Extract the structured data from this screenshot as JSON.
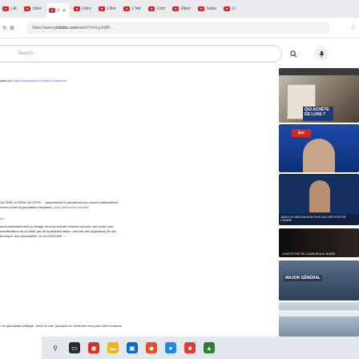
{
  "browser": {
    "tabs": [
      {
        "label": "Lib"
      },
      {
        "label": "Libre"
      },
      {
        "label": "L"
      },
      {
        "label": "Libre"
      },
      {
        "label": "Libre"
      },
      {
        "label": "L'intr"
      },
      {
        "label": "L'intr"
      },
      {
        "label": "Dijon"
      },
      {
        "label": "Suiss"
      },
      {
        "label": "Li"
      }
    ],
    "active_tab_index": 2,
    "url_prefix": "https://www.",
    "url_domain": "youtube.com",
    "url_rest": "/watch?v=ouyIU8F..."
  },
  "youtube": {
    "search_placeholder": "Search",
    "brand_color": "#e02020"
  },
  "description": {
    "line1_prefix": "yalté sur ",
    "line1_link": "https://www.france.tv/france-2/telema...",
    "block2_line1": "Us  DRM, la DRSD, la DGPN ... administrent et perpètrent des crimes extrêmement",
    "block2_line2_prefix": "rment contre la population française). ",
    "block2_line2_link": "https://liberation.website/",
    "block3_heading": "ion",
    "block3_line1": "ntent misérablement (à l'image de leurs activité criminel qui sont une honte pour",
    "block3_line2": "manifestation de la vérité par de la désinformation, meurtre des opposants (et des",
    "block3_line3": "la torture, des représailles, de la CENCURE ...",
    "block4_line1": "r de journaliste politique. Dans ce cas, pourquoi ne continuez vous pas votre émission"
  },
  "recommendations": [
    {
      "caption": "QUI ACHÈTE DE LUXE ?"
    },
    {
      "caption": "Eur"
    },
    {
      "caption": "JEAN-LUC MÉLENCHON FACE AUX DÉPUTÉS DE L'UNION"
    },
    {
      "caption": "LUXE ET FAIT DE L'AMOUR AUX 35 ANS"
    },
    {
      "caption": "MAJOR GÉNÉRAL"
    },
    {
      "caption": ""
    }
  ]
}
